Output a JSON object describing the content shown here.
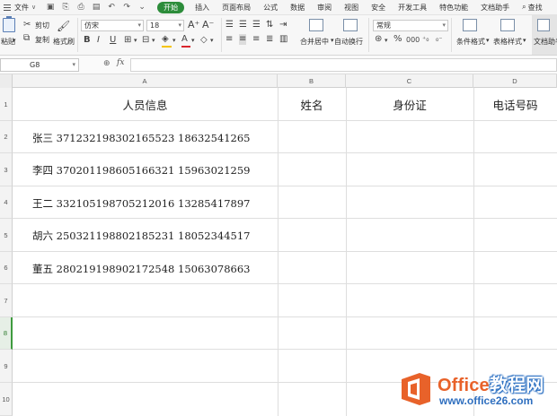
{
  "menubar": {
    "file_label": "文件",
    "tabs": [
      {
        "label": "开始",
        "active": true
      },
      {
        "label": "插入"
      },
      {
        "label": "页面布局"
      },
      {
        "label": "公式"
      },
      {
        "label": "数据"
      },
      {
        "label": "审阅"
      },
      {
        "label": "视图"
      },
      {
        "label": "安全"
      },
      {
        "label": "开发工具"
      },
      {
        "label": "特色功能"
      },
      {
        "label": "文档助手"
      }
    ],
    "search_label": "查找"
  },
  "ribbon": {
    "paste_label": "粘贴",
    "cut_label": "剪切",
    "copy_label": "复制",
    "format_painter_label": "格式刷",
    "font_name": "仿宋",
    "font_size": "18",
    "number_format": "常规",
    "merge_center_label": "合并居中",
    "wrap_text_label": "自动换行",
    "conditional_format_label": "条件格式",
    "table_style_label": "表格样式",
    "doc_assist_label": "文档助手",
    "font_color": "#d9262e",
    "highlight_color": "#f5c400",
    "percent_symbol": "%",
    "thousands_symbol": "000"
  },
  "formula_bar": {
    "cell_ref": "G8",
    "fx_label": "fx",
    "formula_value": ""
  },
  "sheet": {
    "columns": [
      "A",
      "B",
      "C",
      "D"
    ],
    "rows": [
      "1",
      "2",
      "3",
      "4",
      "5",
      "6",
      "7",
      "8",
      "9",
      "10"
    ],
    "selected_row": "8",
    "header": {
      "a": "人员信息",
      "b": "姓名",
      "c": "身份证",
      "d": "电话号码"
    },
    "records": [
      {
        "text": "张三  371232198302165523  18632541265"
      },
      {
        "text": "李四  370201198605166321  15963021259"
      },
      {
        "text": "王二  332105198705212016  13285417897"
      },
      {
        "text": "胡六  250321198802185231  18052344517"
      },
      {
        "text": "董五  280219198902172548  15063078663"
      }
    ]
  },
  "watermark": {
    "brand": "Office",
    "brand_suffix": "教程网",
    "url": "www.office26.com"
  }
}
